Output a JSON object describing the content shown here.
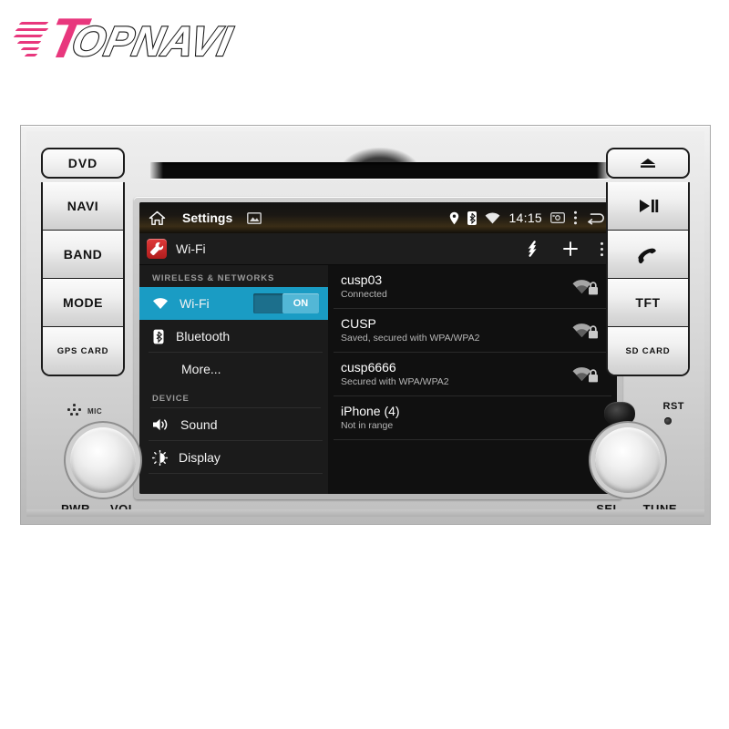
{
  "brand": {
    "logo_t": "T",
    "logo_rest": "OPNAVI",
    "accent_color": "#e8377d",
    "outline_color": "#1a1a1a"
  },
  "unit": {
    "left_buttons": [
      {
        "label": "DVD",
        "name": "dvd"
      },
      {
        "label": "NAVI",
        "name": "navi"
      },
      {
        "label": "BAND",
        "name": "band"
      },
      {
        "label": "MODE",
        "name": "mode"
      },
      {
        "label": "GPS CARD",
        "name": "gps-card"
      }
    ],
    "right_buttons": [
      {
        "label": "▲",
        "name": "eject"
      },
      {
        "label": "▶II",
        "name": "play-pause"
      },
      {
        "label": "phone",
        "name": "phone"
      },
      {
        "label": "TFT",
        "name": "tft"
      },
      {
        "label": "SD CARD",
        "name": "sd-card"
      }
    ],
    "mic_label": "MIC",
    "rst_label": "RST",
    "knob_left_labels": {
      "left": "PWR",
      "right": "VOL"
    },
    "knob_right_labels": {
      "left": "SEL",
      "right": "TUNE"
    }
  },
  "screen": {
    "status_bar": {
      "title": "Settings",
      "clock": "14:15",
      "icons": [
        "home-icon",
        "gallery-icon",
        "location-pin-icon",
        "bluetooth-icon",
        "wifi-icon",
        "screenshot-icon",
        "overflow-menu-icon",
        "back-icon"
      ]
    },
    "action_bar": {
      "title": "Wi-Fi",
      "badge": "settings-wrench-icon",
      "icons": [
        "wps-icon",
        "add-icon",
        "overflow-menu-icon"
      ]
    },
    "nav": {
      "sections": [
        {
          "header": "WIRELESS & NETWORKS",
          "items": [
            {
              "label": "Wi-Fi",
              "icon": "wifi-icon",
              "selected": true,
              "toggle": "ON"
            },
            {
              "label": "Bluetooth",
              "icon": "bluetooth-icon",
              "selected": false
            },
            {
              "label": "More...",
              "icon": "none",
              "selected": false,
              "indent": true
            }
          ]
        },
        {
          "header": "DEVICE",
          "items": [
            {
              "label": "Sound",
              "icon": "sound-icon",
              "selected": false
            },
            {
              "label": "Display",
              "icon": "display-icon",
              "selected": false
            }
          ]
        }
      ]
    },
    "wifi_networks": [
      {
        "ssid": "cusp03",
        "status": "Connected",
        "signal": 3,
        "secured": true
      },
      {
        "ssid": "CUSP",
        "status": "Saved, secured with WPA/WPA2",
        "signal": 3,
        "secured": true
      },
      {
        "ssid": "cusp6666",
        "status": "Secured with WPA/WPA2",
        "signal": 3,
        "secured": true
      },
      {
        "ssid": "iPhone (4)",
        "status": "Not in range",
        "signal": 0,
        "secured": false
      }
    ]
  }
}
